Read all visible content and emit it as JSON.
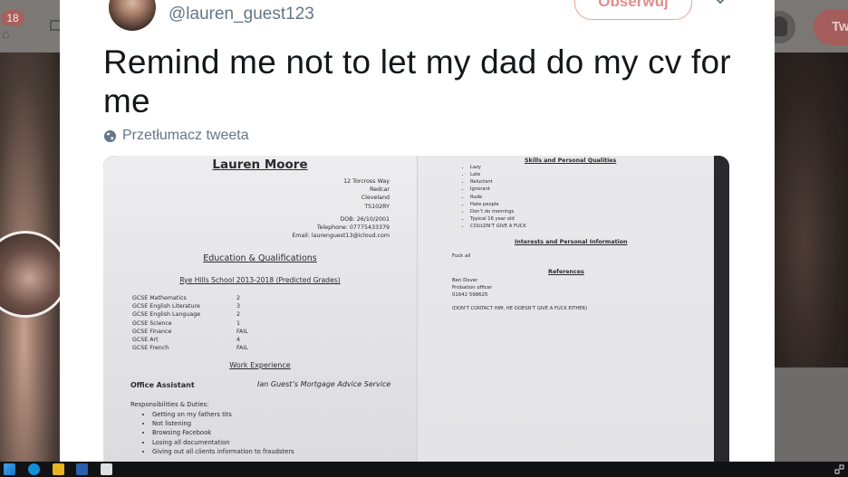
{
  "background": {
    "notification_count": "18",
    "tweet_button_label": "Tw",
    "icons": [
      "home-icon",
      "mail-icon",
      "profile-icon"
    ]
  },
  "tweet": {
    "handle": "@lauren_guest123",
    "follow_label": "Obserwuj",
    "text": "Remind me not to let my dad do my cv for me",
    "translate_label": "Przetłumacz tweeta"
  },
  "cv": {
    "name": "Lauren Moore",
    "address": [
      "12 Torcross Way",
      "Redcar",
      "Cleveland",
      "TS102RY"
    ],
    "contact": [
      "DOB: 26/10/2001",
      "Telephone: 07775433379",
      "Email: laurenguest13@icloud.com"
    ],
    "education_heading": "Education & Qualifications",
    "school": "Rye Hills School 2013-2018 (Predicted Grades)",
    "grades": [
      {
        "subject": "GCSE Mathematics",
        "grade": "2"
      },
      {
        "subject": "GCSE English Literature",
        "grade": "3"
      },
      {
        "subject": "GCSE English Language",
        "grade": "2"
      },
      {
        "subject": "GCSE Science",
        "grade": "1"
      },
      {
        "subject": "GCSE Finance",
        "grade": "FAIL"
      },
      {
        "subject": "GCSE Art",
        "grade": "4"
      },
      {
        "subject": "GCSE French",
        "grade": "FAIL"
      }
    ],
    "work_heading": "Work Experience",
    "job_title": "Office Assistant",
    "company": "Ian Guest’s Mortgage Advice Service",
    "responsibilities_title": "Responsibilities & Duties:",
    "responsibilities": [
      "Getting on my fathers tits",
      "Not listening",
      "Browsing Facebook",
      "Losing all documentation",
      "Giving out all clients information to fraudsters"
    ],
    "skills_heading": "Skills and Personal Qualities",
    "skills": [
      "Lazy",
      "Late",
      "Reluctant",
      "Ignorant",
      "Rude",
      "Hate people",
      "Don’t do mornings",
      "Typical 16 year old",
      "COULDN’T GIVE A FUCK"
    ],
    "interests_heading": "Interests and Personal Information",
    "interests": "Fuck all",
    "references_heading": "References",
    "references": [
      "Ben Dover",
      "Probation officer",
      "01642 598625"
    ],
    "references_note": "(DON’T CONTACT HIM, HE DOESN’T GIVE A FUCK EITHER)"
  },
  "taskbar": {
    "apps": [
      "start-icon",
      "skype-icon",
      "outlook-icon",
      "word-icon",
      "photos-icon",
      "network-icon"
    ]
  }
}
